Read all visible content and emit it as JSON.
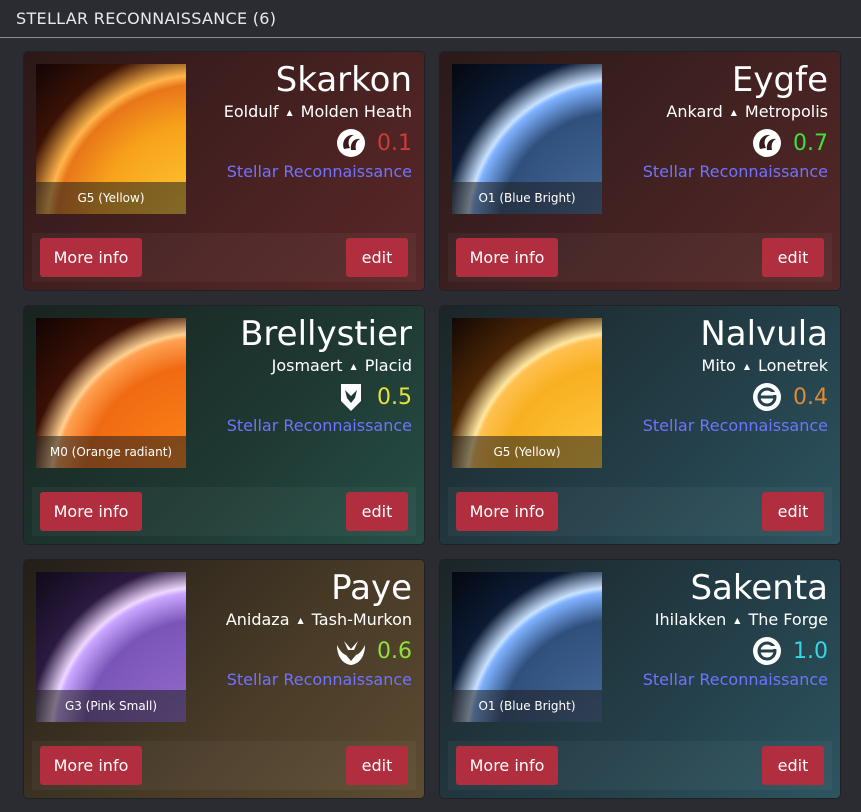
{
  "header": {
    "title": "STELLAR RECONNAISSANCE (6)"
  },
  "colors": {
    "button": "#b02e3d",
    "link": "#6f73ff"
  },
  "cards": [
    {
      "name": "Skarkon",
      "constellation": "Eoldulf",
      "region": "Molden Heath",
      "security": "0.1",
      "security_color": "#d23a32",
      "faction_icon": "minmatar-icon",
      "link": "Stellar Reconnaissance",
      "spectral": "G5 (Yellow)",
      "star_color": "yellow",
      "more_label": "More info",
      "edit_label": "edit"
    },
    {
      "name": "Eygfe",
      "constellation": "Ankard",
      "region": "Metropolis",
      "security": "0.7",
      "security_color": "#3ee23a",
      "faction_icon": "minmatar-icon",
      "link": "Stellar Reconnaissance",
      "spectral": "O1 (Blue Bright)",
      "star_color": "blue",
      "more_label": "More info",
      "edit_label": "edit"
    },
    {
      "name": "Brellystier",
      "constellation": "Josmaert",
      "region": "Placid",
      "security": "0.5",
      "security_color": "#e6e33a",
      "faction_icon": "gallente-icon",
      "link": "Stellar Reconnaissance",
      "spectral": "M0 (Orange radiant)",
      "star_color": "orange",
      "more_label": "More info",
      "edit_label": "edit"
    },
    {
      "name": "Nalvula",
      "constellation": "Mito",
      "region": "Lonetrek",
      "security": "0.4",
      "security_color": "#e08a35",
      "faction_icon": "caldari-icon",
      "link": "Stellar Reconnaissance",
      "spectral": "G5 (Yellow)",
      "star_color": "yellow",
      "more_label": "More info",
      "edit_label": "edit"
    },
    {
      "name": "Paye",
      "constellation": "Anidaza",
      "region": "Tash-Murkon",
      "security": "0.6",
      "security_color": "#8fe23a",
      "faction_icon": "amarr-icon",
      "link": "Stellar Reconnaissance",
      "spectral": "G3 (Pink Small)",
      "star_color": "pink",
      "more_label": "More info",
      "edit_label": "edit"
    },
    {
      "name": "Sakenta",
      "constellation": "Ihilakken",
      "region": "The Forge",
      "security": "1.0",
      "security_color": "#35d6e6",
      "faction_icon": "caldari-icon",
      "link": "Stellar Reconnaissance",
      "spectral": "O1 (Blue Bright)",
      "star_color": "blue",
      "more_label": "More info",
      "edit_label": "edit"
    }
  ]
}
